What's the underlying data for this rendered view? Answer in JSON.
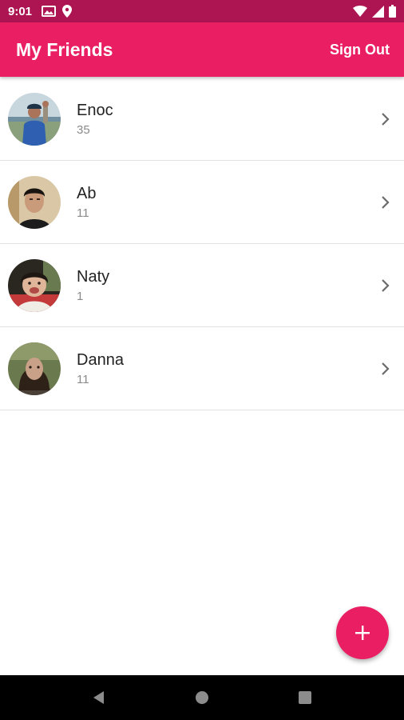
{
  "status_bar": {
    "time": "9:01",
    "left_icons": [
      "gallery-icon",
      "location-pin-icon"
    ],
    "right_icons": [
      "wifi-icon",
      "cell-signal-icon",
      "battery-icon"
    ]
  },
  "app_bar": {
    "title": "My Friends",
    "action_label": "Sign Out"
  },
  "friends": [
    {
      "name": "Enoc",
      "count": "35",
      "avatar": "photo of person holding a fish"
    },
    {
      "name": "Ab",
      "count": "11",
      "avatar": "photo of young man"
    },
    {
      "name": "Naty",
      "count": "1",
      "avatar": "photo of smiling child"
    },
    {
      "name": "Danna",
      "count": "11",
      "avatar": "photo of woman outdoors"
    }
  ],
  "fab": {
    "icon": "plus-icon"
  },
  "nav_bar": {
    "icons": [
      "back-icon",
      "home-icon",
      "recents-icon"
    ]
  },
  "colors": {
    "status_bar": "#ad1452",
    "primary": "#e91e63",
    "divider": "#e2e2e2",
    "name_text": "#222222",
    "count_text": "#8a8a8a"
  }
}
